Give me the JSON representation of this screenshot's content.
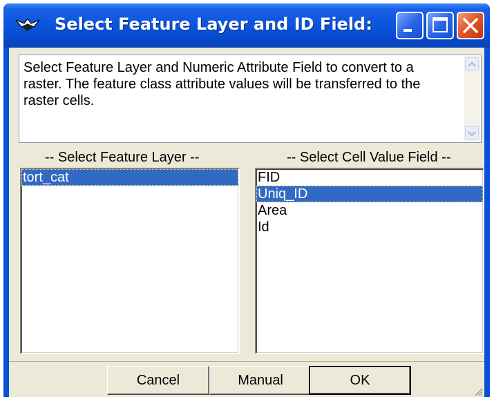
{
  "window": {
    "title": "Select Feature Layer and ID Field:",
    "icon": "app-icon",
    "controls": [
      "minimize-icon",
      "maximize-icon",
      "close-icon"
    ]
  },
  "description": {
    "text": "Select Feature Layer and Numeric Attribute Field to convert to a raster.  The feature class attribute values will be transferred to the raster cells."
  },
  "feature_layer": {
    "header": "-- Select Feature Layer --",
    "items": [
      {
        "label": "tort_cat",
        "selected": true
      }
    ]
  },
  "cell_value_field": {
    "header": "-- Select Cell Value Field --",
    "items": [
      {
        "label": "FID",
        "selected": false
      },
      {
        "label": "Uniq_ID",
        "selected": true
      },
      {
        "label": "Area",
        "selected": false
      },
      {
        "label": "Id",
        "selected": false
      }
    ]
  },
  "buttons": {
    "cancel": "Cancel",
    "manual": "Manual",
    "ok": "OK"
  },
  "colors": {
    "titlebar": "#0a52dc",
    "selection": "#316ac5",
    "face": "#ece9d8",
    "close": "#e05a2a"
  }
}
